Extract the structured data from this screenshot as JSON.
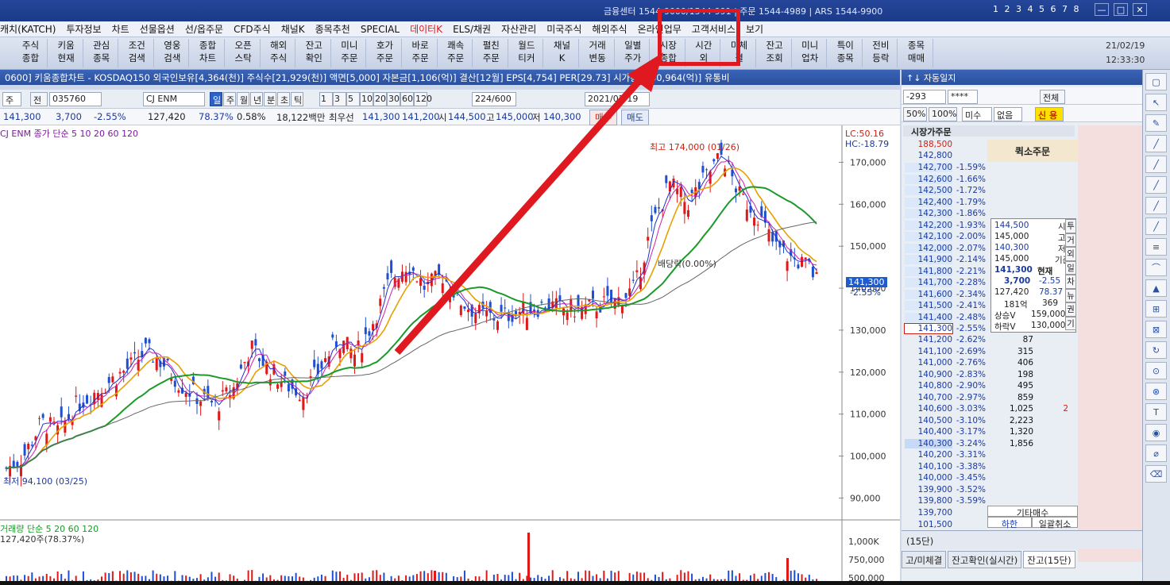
{
  "topbar": {
    "contact": "금융센터 1544-9000/1544-991  |  주문 1544-4989  |  ARS 1544-9900",
    "screen_nums": "1 2 3 4 5 6 7 8",
    "min_btn": "—",
    "max_btn": "□",
    "close_btn": "✕"
  },
  "menu": [
    "캐치(KATCH)",
    "투자정보",
    "차트",
    "선물옵션",
    "선/옵주문",
    "CFD주식",
    "채널K",
    "종목추천",
    "SPECIAL",
    "데이터K",
    "ELS/채권",
    "자산관리",
    "미국주식",
    "해외주식",
    "온라인업무",
    "고객서비스",
    "보기"
  ],
  "menu_highlight_index": 9,
  "toolbar": [
    [
      "주식",
      "종합"
    ],
    [
      "키움",
      "현재"
    ],
    [
      "관심",
      "종목"
    ],
    [
      "조건",
      "검색"
    ],
    [
      "영웅",
      "검색"
    ],
    [
      "종합",
      "차트"
    ],
    [
      "오픈",
      "스탁"
    ],
    [
      "해외",
      "주식"
    ],
    [
      "잔고",
      "확인"
    ],
    [
      "미니",
      "주문"
    ],
    [
      "호가",
      "주문"
    ],
    [
      "바로",
      "주문"
    ],
    [
      "쾌속",
      "주문"
    ],
    [
      "펼친",
      "주문"
    ],
    [
      "월드",
      "티커"
    ],
    [
      "채널",
      "K"
    ],
    [
      "거래",
      "변동"
    ],
    [
      "일별",
      "주가"
    ],
    [
      "시장",
      "종합"
    ],
    [
      "시간",
      "외"
    ],
    [
      "미체",
      "결"
    ],
    [
      "잔고",
      "조회"
    ],
    [
      "미니",
      "업차"
    ],
    [
      "특이",
      "종목"
    ],
    [
      "전비",
      "등락"
    ],
    [
      "종목",
      "매매"
    ]
  ],
  "datetime": {
    "date": "21/02/19",
    "time": "12:33:30"
  },
  "chart_window": {
    "title": "0600] 키움종합차트 - KOSDAQ150 외국인보유[4,364(천)] 주식수[21,929(천)] 액면[5,000] 자본금[1,106(억)] 결산[12월] EPS[4,754] PER[29.73] 시가총액[30,964(억)] 유통비",
    "code": "035760",
    "name": "CJ ENM",
    "prefix1": "주",
    "prefix2": "전",
    "periods": [
      "일",
      "주",
      "월",
      "년",
      "분",
      "초",
      "틱"
    ],
    "intervals": [
      "1",
      "3",
      "5",
      "10",
      "20",
      "30",
      "60",
      "120"
    ],
    "count": "224/600",
    "date": "2021/02/19",
    "quote": {
      "price": "141,300",
      "change": "3,700",
      "rate": "-2.55%",
      "volume": "127,420",
      "vol_ratio": "78.37%",
      "turnover": "0.58%",
      "amount": "18,122백만",
      "best": "최우선",
      "ask": "141,300",
      "bid": "141,200",
      "open_lbl": "시",
      "open": "144,500",
      "high_lbl": "고",
      "high": "145,000",
      "low_lbl": "저",
      "low": "140,300",
      "buy": "매수",
      "sell": "매도"
    },
    "legend_price": "CJ ENM  종가 단순 5  10  20  60  120",
    "legend_vol": "거래량  단순 5  20  60  120",
    "vol_info": "127,420주(78.37%)",
    "lc_hc": [
      "LC:50.16",
      "HC:-18.79"
    ],
    "high_label": "최고 174,000 (01/26)",
    "low_label": "최저 94,100 (03/25)",
    "dividend": "배당락(0.00%)",
    "last_price": "141,300",
    "last_rate": "-2.55%"
  },
  "chart_data": {
    "type": "candlestick",
    "ylim": [
      88000,
      175000
    ],
    "yticks": [
      "170,000",
      "160,000",
      "150,000",
      "140,000",
      "130,000",
      "120,000",
      "110,000",
      "100,000",
      "90,000"
    ],
    "vol_ticks": [
      "1,000K",
      "750,000",
      "500,000"
    ],
    "series": [
      {
        "name": "종가 단순 5",
        "color": "#1c2fd0"
      },
      {
        "name": "종가 단순 10",
        "color": "#cc22aa"
      },
      {
        "name": "종가 단순 20",
        "color": "#e8a000"
      },
      {
        "name": "종가 단순 60",
        "color": "#1a9a28"
      },
      {
        "name": "종가 단순 120",
        "color": "#666666"
      }
    ],
    "close_points": [
      [
        0,
        97000
      ],
      [
        10,
        100000
      ],
      [
        20,
        108000
      ],
      [
        30,
        106000
      ],
      [
        40,
        112000
      ],
      [
        50,
        115000
      ],
      [
        60,
        118000
      ],
      [
        70,
        121000
      ],
      [
        80,
        125000
      ],
      [
        90,
        122000
      ],
      [
        100,
        117000
      ],
      [
        110,
        114000
      ],
      [
        120,
        112000
      ],
      [
        130,
        116000
      ],
      [
        140,
        126000
      ],
      [
        150,
        121000
      ],
      [
        160,
        117000
      ],
      [
        170,
        115000
      ],
      [
        180,
        121000
      ],
      [
        190,
        128000
      ],
      [
        200,
        124000
      ],
      [
        210,
        132000
      ],
      [
        220,
        142000
      ],
      [
        230,
        146000
      ],
      [
        240,
        140000
      ],
      [
        250,
        143000
      ],
      [
        260,
        137000
      ],
      [
        270,
        134000
      ],
      [
        280,
        133000
      ],
      [
        290,
        134000
      ],
      [
        300,
        135000
      ],
      [
        310,
        136000
      ],
      [
        320,
        135000
      ],
      [
        330,
        135000
      ],
      [
        340,
        136000
      ],
      [
        350,
        137000
      ],
      [
        360,
        140000
      ],
      [
        370,
        155000
      ],
      [
        380,
        165000
      ],
      [
        390,
        160000
      ],
      [
        400,
        166000
      ],
      [
        410,
        172000
      ],
      [
        420,
        162000
      ],
      [
        430,
        158000
      ],
      [
        440,
        150000
      ],
      [
        450,
        147000
      ],
      [
        460,
        145000
      ],
      [
        465,
        141300
      ]
    ]
  },
  "order_panel": {
    "title": "↑↓ 자동일지",
    "code": "-293",
    "mask": "****",
    "all": "전체",
    "pct50": "50%",
    "pct100": "100%",
    "unfilled": "미수",
    "none": "없음",
    "credit": "신 용",
    "header": "시장가주문",
    "quick_cancel": "퀵소주문",
    "top_prices": [
      "188,500",
      "142,800"
    ],
    "asks": [
      [
        "142,700",
        "-1.59%"
      ],
      [
        "142,600",
        "-1.66%"
      ],
      [
        "142,500",
        "-1.72%"
      ],
      [
        "142,400",
        "-1.79%"
      ],
      [
        "142,300",
        "-1.86%"
      ],
      [
        "142,200",
        "-1.93%"
      ],
      [
        "142,100",
        "-2.00%"
      ],
      [
        "142,000",
        "-2.07%"
      ],
      [
        "141,900",
        "-2.14%"
      ],
      [
        "141,800",
        "-2.21%"
      ],
      [
        "141,700",
        "-2.28%"
      ],
      [
        "141,600",
        "-2.34%"
      ],
      [
        "141,500",
        "-2.41%"
      ],
      [
        "141,400",
        "-2.48%"
      ],
      [
        "141,300",
        "-2.55%"
      ]
    ],
    "bids": [
      [
        "141,200",
        "-2.62%",
        "87",
        ""
      ],
      [
        "141,100",
        "-2.69%",
        "315",
        ""
      ],
      [
        "141,000",
        "-2.76%",
        "406",
        ""
      ],
      [
        "140,900",
        "-2.83%",
        "198",
        ""
      ],
      [
        "140,800",
        "-2.90%",
        "495",
        ""
      ],
      [
        "140,700",
        "-2.97%",
        "859",
        ""
      ],
      [
        "140,600",
        "-3.03%",
        "1,025",
        "2"
      ],
      [
        "140,500",
        "-3.10%",
        "2,223",
        ""
      ],
      [
        "140,400",
        "-3.17%",
        "1,320",
        ""
      ],
      [
        "140,300",
        "-3.24%",
        "1,856",
        ""
      ],
      [
        "140,200",
        "-3.31%",
        "",
        ""
      ],
      [
        "140,100",
        "-3.38%",
        "",
        ""
      ],
      [
        "140,000",
        "-3.45%",
        "",
        ""
      ],
      [
        "139,900",
        "-3.52%",
        "",
        ""
      ],
      [
        "139,800",
        "-3.59%",
        "",
        ""
      ]
    ],
    "bottom_prices": [
      "139,700",
      "101,500"
    ],
    "info": {
      "open": "144,500",
      "open_l": "시",
      "high": "145,000",
      "high_l": "고",
      "low": "140,300",
      "low_l": "저",
      "base": "145,000",
      "base_l": "기준",
      "cur": "141,300",
      "cur_l": "현재",
      "chg": "3,700",
      "rate": "-2.55",
      "vol": "127,420",
      "vr": "78.37",
      "amt": "181억",
      "n": "369",
      "up": "상승V",
      "upv": "159,000",
      "dn": "하락V",
      "dnv": "130,000"
    },
    "side_tabs": [
      "투",
      "거",
      "외",
      "일",
      "차",
      "뉴",
      "권",
      "기"
    ],
    "other": "기타매수",
    "lower_limit": "하한",
    "cancel_all": "일괄취소",
    "bottom_title": "(15단)",
    "tabs": [
      "고/미체결",
      "잔고확인(실시간)",
      "잔고(15단)"
    ]
  }
}
